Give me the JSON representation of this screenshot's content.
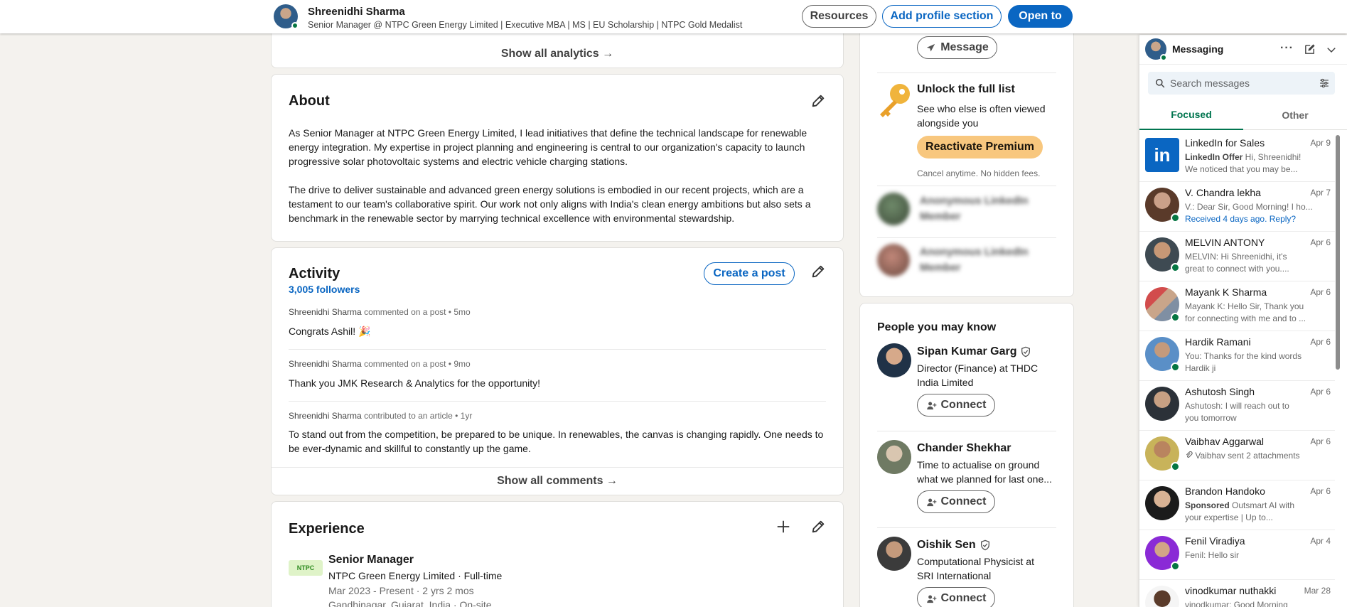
{
  "header": {
    "name": "Shreenidhi Sharma",
    "headline": "Senior Manager @ NTPC Green Energy Limited | Executive MBA | MS | EU Scholarship | NTPC Gold Medalist",
    "resources_label": "Resources",
    "add_section_label": "Add profile section",
    "open_to_label": "Open to"
  },
  "analytics": {
    "show_all_label": "Show all analytics →"
  },
  "about": {
    "title": "About",
    "para1": "As Senior Manager at NTPC Green Energy Limited, I lead initiatives that define the technical landscape for renewable energy integration. My expertise in project planning and engineering is central to our organization's capacity to launch progressive solar photovoltaic systems and electric vehicle charging stations.",
    "para2": "The drive to deliver sustainable and advanced green energy solutions is embodied in our recent projects, which are a testament to our team's collaborative spirit. Our work not only aligns with India's clean energy ambitions but also sets a benchmark in the renewable sector by marrying technical excellence with environmental stewardship."
  },
  "activity": {
    "title": "Activity",
    "followers": "3,005 followers",
    "create_post_label": "Create a post",
    "posts": [
      {
        "author": "Shreenidhi Sharma",
        "action": " commented on a post • 5mo",
        "text": "Congrats Ashil! 🎉"
      },
      {
        "author": "Shreenidhi Sharma",
        "action": " commented on a post • 9mo",
        "text": "Thank you JMK Research & Analytics for the opportunity!"
      },
      {
        "author": "Shreenidhi Sharma",
        "action": " contributed to an article • 1yr",
        "text": "To stand out from the competition, be prepared to be unique. In renewables, the canvas is changing rapidly. One needs to be ever-dynamic and skillful to constantly up the game."
      }
    ],
    "show_all_label": "Show all comments →"
  },
  "experience": {
    "title": "Experience",
    "role": "Senior Manager",
    "company": "NTPC Green Energy Limited · Full-time",
    "dates": "Mar 2023 - Present · 2 yrs 2 mos",
    "location": "Gandhinagar, Gujarat, India · On-site",
    "logo_text": "NTPC"
  },
  "sidebar": {
    "message_label": "Message",
    "unlock_title": "Unlock the full list",
    "unlock_desc": "See who else is often viewed alongside you",
    "reactivate_label": "Reactivate Premium",
    "cancel_note": "Cancel anytime. No hidden fees.",
    "anon_label": "Anonymous LinkedIn Member",
    "pymk_title": "People you may know",
    "connect_label": "Connect",
    "people": [
      {
        "name": "Sipan Kumar Garg",
        "headline": "Director (Finance) at THDC India Limited"
      },
      {
        "name": "Chander Shekhar",
        "headline": "Time to actualise on ground what we planned for last one..."
      },
      {
        "name": "Oishik Sen",
        "headline": "Computational Physicist at SRI International"
      }
    ]
  },
  "messaging": {
    "title": "Messaging",
    "search_placeholder": "Search messages",
    "tabs": [
      "Focused",
      "Other"
    ],
    "conversations": [
      {
        "name": "LinkedIn for Sales",
        "date": "Apr 9",
        "tag": "LinkedIn Offer",
        "line1": "  Hi, Shreenidhi!",
        "line2": "We noticed that you may be..."
      },
      {
        "name": "V. Chandra lekha",
        "date": "Apr 7",
        "line1": "V.: Dear Sir, Good Morning! I ho...",
        "line2": "Received 4 days ago. Reply?"
      },
      {
        "name": "MELVIN ANTONY",
        "date": "Apr 6",
        "line1": "MELVIN: Hi Shreenidhi, it's",
        "line2": "great to connect with you...."
      },
      {
        "name": "Mayank K Sharma",
        "date": "Apr 6",
        "line1": "Mayank K: Hello Sir, Thank you",
        "line2": "for connecting with me and to ..."
      },
      {
        "name": "Hardik Ramani",
        "date": "Apr 6",
        "line1": "You: Thanks for the kind words",
        "line2": "Hardik ji"
      },
      {
        "name": "Ashutosh Singh",
        "date": "Apr 6",
        "line1": "Ashutosh: I will reach out to",
        "line2": "you tomorrow"
      },
      {
        "name": "Vaibhav Aggarwal",
        "date": "Apr 6",
        "line1": "Vaibhav sent 2 attachments",
        "line2": ""
      },
      {
        "name": "Brandon Handoko",
        "date": "Apr 6",
        "tag": "Sponsored",
        "line1": "  Outsmart AI with",
        "line2": "your expertise | Up to..."
      },
      {
        "name": "Fenil Viradiya",
        "date": "Apr 4",
        "line1": "Fenil: Hello sir",
        "line2": ""
      },
      {
        "name": "vinodkumar nuthakki",
        "date": "Mar 28",
        "line1": "vinodkumar: Good Morning",
        "line2": ""
      }
    ]
  },
  "colors": {
    "brand_blue": "#0a66c2",
    "online_green": "#057642",
    "premium_gold": "#f8c77e",
    "page_bg": "#f4f2ee"
  }
}
